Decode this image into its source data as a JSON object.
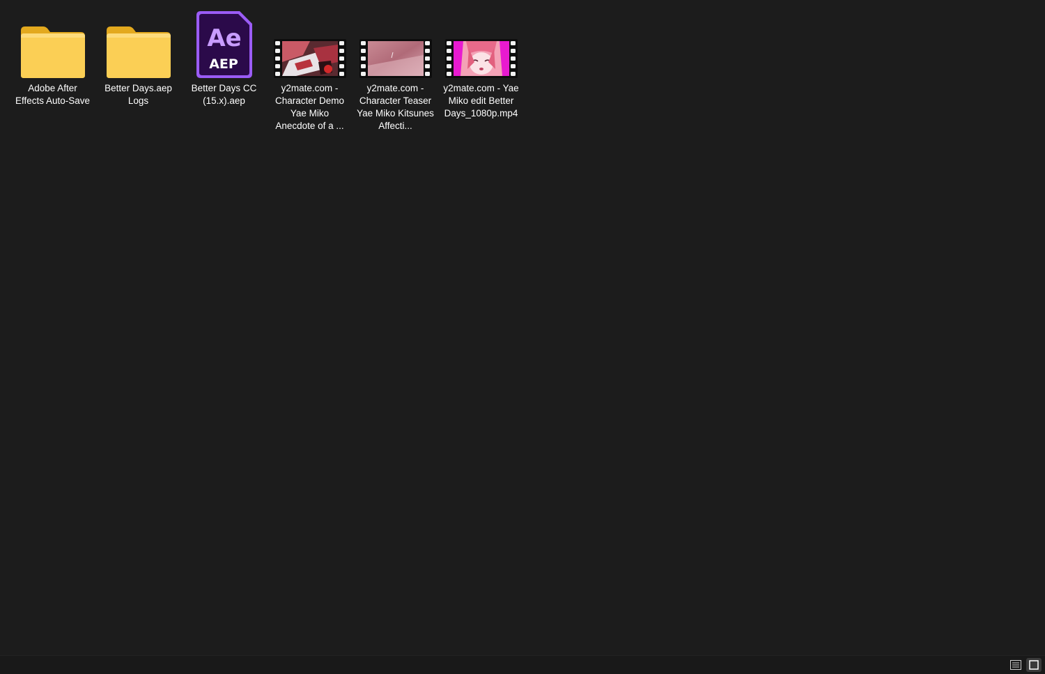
{
  "files": [
    {
      "name": "Adobe After Effects Auto-Save",
      "type": "folder"
    },
    {
      "name": "Better Days.aep Logs",
      "type": "folder"
    },
    {
      "name": "Better Days CC (15.x).aep",
      "type": "aep",
      "icon_text_top": "Ae",
      "icon_text_bottom": "AEP"
    },
    {
      "name": "y2mate.com - Character Demo Yae Miko Anecdote of a ...",
      "type": "video"
    },
    {
      "name": "y2mate.com - Character Teaser Yae Miko Kitsunes Affecti...",
      "type": "video"
    },
    {
      "name": "y2mate.com - Yae Miko edit Better Days_1080p.mp4",
      "type": "video"
    }
  ],
  "colors": {
    "background": "#1c1c1c",
    "folder": "#f8c84a",
    "aep_bg": "#2a0a48",
    "aep_accent": "#9b5cf6",
    "text": "#ffffff"
  },
  "status_bar": {
    "details_view": "list-view-icon",
    "tiles_view": "large-icons-view-icon"
  }
}
